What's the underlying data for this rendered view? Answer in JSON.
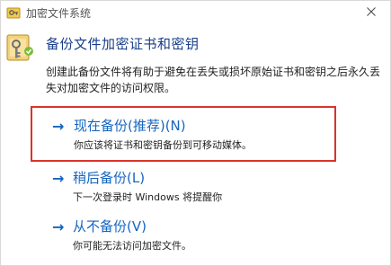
{
  "window": {
    "title": "加密文件系统"
  },
  "header": {
    "heading": "备份文件加密证书和密钥",
    "description": "创建此备份文件将有助于避免在丢失或损坏原始证书和密钥之后永久丢失对加密文件的访问权限。"
  },
  "options": [
    {
      "arrow": "→",
      "title": "现在备份(推荐)(N)",
      "subtitle": "你应该将证书和密钥备份到可移动媒体。"
    },
    {
      "arrow": "→",
      "title": "稍后备份(L)",
      "subtitle": "下一次登录时 Windows 将提醒你"
    },
    {
      "arrow": "→",
      "title": "从不备份(V)",
      "subtitle": "你可能无法访问加密文件。"
    }
  ],
  "colors": {
    "highlight_border": "#d9332b",
    "link_blue": "#1565c0",
    "heading_blue": "#1a3f8a"
  },
  "icons": {
    "title_icon": "efs-key-icon",
    "header_icon": "key-certificate-icon",
    "close_icon": "close-icon",
    "option_icon": "arrow-right-icon"
  }
}
